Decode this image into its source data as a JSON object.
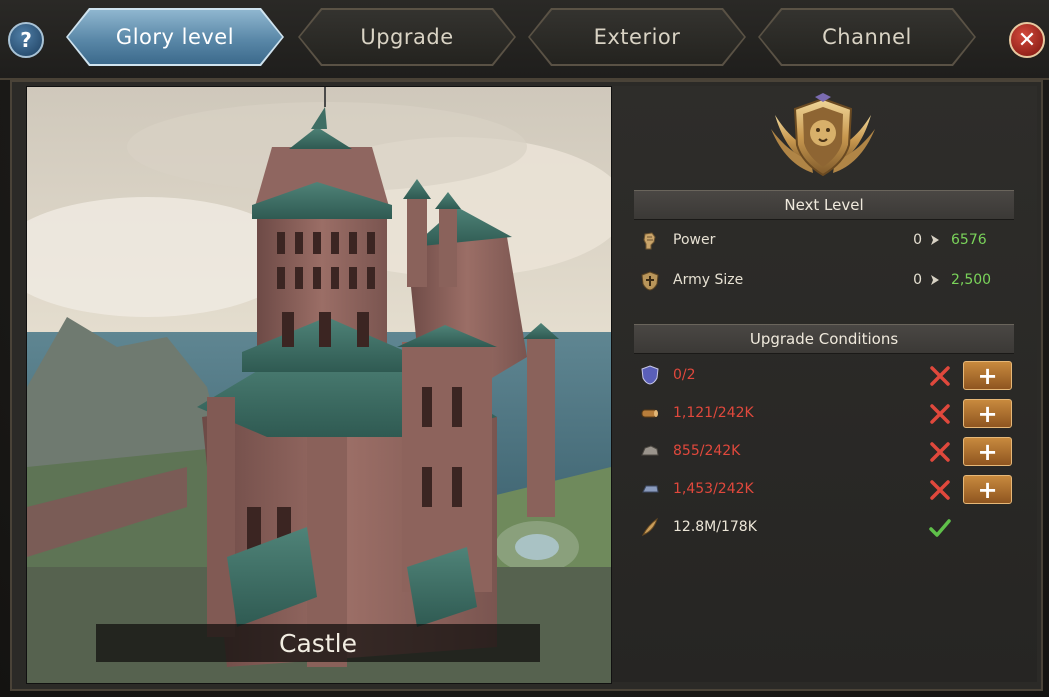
{
  "tabs": [
    {
      "label": "Glory level",
      "active": true
    },
    {
      "label": "Upgrade",
      "active": false
    },
    {
      "label": "Exterior",
      "active": false
    },
    {
      "label": "Channel",
      "active": false
    }
  ],
  "buttons": {
    "help_label": "?",
    "close_label": "✕"
  },
  "building": {
    "name": "Castle"
  },
  "next_level": {
    "header": "Next Level",
    "stats": [
      {
        "name": "Power",
        "from": "0",
        "to": "6576",
        "icon": "fist-icon"
      },
      {
        "name": "Army Size",
        "from": "0",
        "to": "2,500",
        "icon": "army-shield-icon"
      }
    ]
  },
  "conditions": {
    "header": "Upgrade Conditions",
    "items": [
      {
        "value": "0/2",
        "met": false,
        "icon": "crest-icon",
        "plus": "+"
      },
      {
        "value": "1,121/242K",
        "met": false,
        "icon": "wood-icon",
        "plus": "+"
      },
      {
        "value": "855/242K",
        "met": false,
        "icon": "stone-icon",
        "plus": "+"
      },
      {
        "value": "1,453/242K",
        "met": false,
        "icon": "iron-icon",
        "plus": "+"
      },
      {
        "value": "12.8M/178K",
        "met": true,
        "icon": "feather-icon"
      }
    ]
  },
  "colors": {
    "accent_tab": "#5a88a8",
    "unmet": "#e0483c",
    "met": "#5fc04a",
    "gain": "#7ad35a",
    "plus_button": "#c88a3e"
  }
}
